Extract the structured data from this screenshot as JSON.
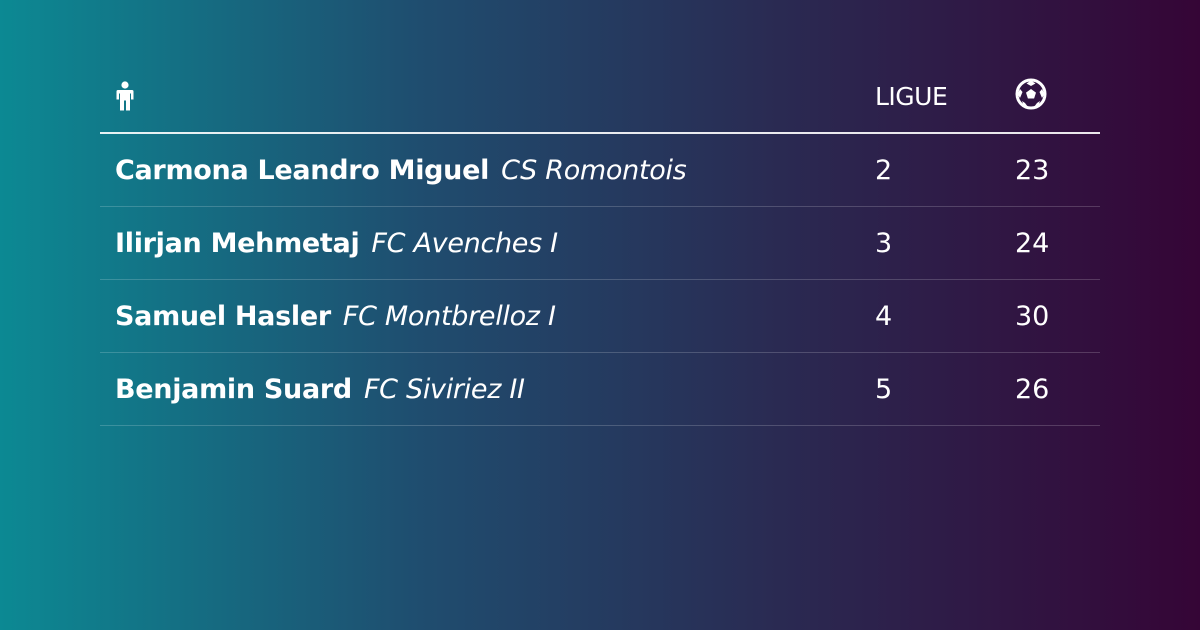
{
  "header": {
    "player_icon": "person-icon",
    "league_label": "LIGUE",
    "goals_icon": "soccer-ball-icon"
  },
  "rows": [
    {
      "player": "Carmona Leandro Miguel",
      "club": "CS Romontois",
      "league": "2",
      "goals": "23"
    },
    {
      "player": "Ilirjan Mehmetaj",
      "club": "FC Avenches I",
      "league": "3",
      "goals": "24"
    },
    {
      "player": "Samuel Hasler",
      "club": "FC Montbrelloz I",
      "league": "4",
      "goals": "30"
    },
    {
      "player": "Benjamin Suard",
      "club": "FC Siviriez II",
      "league": "5",
      "goals": "26"
    }
  ],
  "colors": {
    "gradient_start": "#0c8993",
    "gradient_end": "#350536",
    "text": "#ffffff"
  }
}
